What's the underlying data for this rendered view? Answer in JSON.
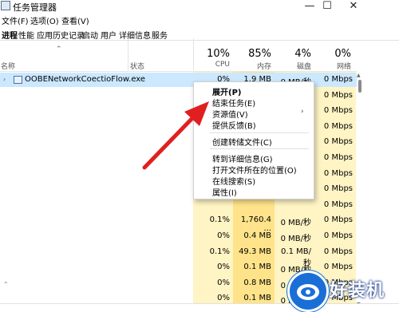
{
  "window": {
    "title": "任务管理器",
    "controls": {
      "minimize": "—",
      "maximize": "☐",
      "close": "✕"
    }
  },
  "menubar": {
    "items": [
      "文件(F)",
      "选项(O)",
      "查看(V)"
    ]
  },
  "tabs": [
    {
      "label": "进程",
      "active": true
    },
    {
      "label": "性能",
      "active": false
    },
    {
      "label": "应用历史记录",
      "active": false
    },
    {
      "label": "启动",
      "active": false
    },
    {
      "label": "用户",
      "active": false
    },
    {
      "label": "详细信息",
      "active": false
    },
    {
      "label": "服务",
      "active": false
    }
  ],
  "columns": {
    "name": "名称",
    "status": "状态",
    "cpu": {
      "pct": "10%",
      "label": "CPU"
    },
    "memory": {
      "pct": "85%",
      "label": "内存"
    },
    "disk": {
      "pct": "4%",
      "label": "磁盘"
    },
    "network": {
      "pct": "0%",
      "label": "网络"
    }
  },
  "selected_process": "OOBENetworkCoectioFlow.exe",
  "rows": [
    {
      "cpu": "0%",
      "mem": "1.9 MB",
      "disk": "0 MB/秒",
      "net": "0 Mbps"
    },
    {
      "cpu": "",
      "mem": "",
      "disk": "",
      "net": "0 Mbps"
    },
    {
      "cpu": "",
      "mem": "",
      "disk": "",
      "net": "0 Mbps"
    },
    {
      "cpu": "",
      "mem": "",
      "disk": "",
      "net": "0 Mbps"
    },
    {
      "cpu": "",
      "mem": "",
      "disk": "",
      "net": "0 Mbps"
    },
    {
      "cpu": "",
      "mem": "",
      "disk": "",
      "net": "0 Mbps"
    },
    {
      "cpu": "",
      "mem": "",
      "disk": "",
      "net": "0 Mbps"
    },
    {
      "cpu": "",
      "mem": "",
      "disk": "",
      "net": "0 Mbps"
    },
    {
      "cpu": "",
      "mem": "",
      "disk": "",
      "net": "0 Mbps"
    },
    {
      "cpu": "0.1%",
      "mem": "1,760.4 ...",
      "disk": "0 MB/秒",
      "net": "0 Mbps"
    },
    {
      "cpu": "0%",
      "mem": "0.4 MB",
      "disk": "0 MB/秒",
      "net": "0 Mbps"
    },
    {
      "cpu": "0.1%",
      "mem": "49.3 MB",
      "disk": "0.1 MB/秒",
      "net": "0 Mbps"
    },
    {
      "cpu": "0%",
      "mem": "0.1 MB",
      "disk": "0 MB/秒",
      "net": "0 Mbps"
    },
    {
      "cpu": "0%",
      "mem": "0.8 MB",
      "disk": "0 MB/秒",
      "net": "0 Mbps"
    },
    {
      "cpu": "0%",
      "mem": "0.1 MB",
      "disk": "0 MB/秒",
      "net": "0 Mbps"
    }
  ],
  "context_menu": {
    "items": [
      {
        "label": "展开(P)",
        "bold": true
      },
      {
        "label": "结束任务(E)"
      },
      {
        "label": "资源值(V)",
        "submenu": true
      },
      {
        "label": "提供反馈(B)"
      },
      {
        "label": "创建转储文件(C)"
      },
      {
        "label": "转到详细信息(G)"
      },
      {
        "label": "打开文件所在的位置(O)"
      },
      {
        "label": "在线搜索(S)"
      },
      {
        "label": "属性(I)"
      }
    ]
  },
  "watermark": {
    "text": "好装机"
  },
  "colors": {
    "selected_row": "#cce8ff",
    "cpu_col": "#fff4c4",
    "mem_col": "#ffe38a",
    "disk_col": "#fff4c4",
    "net_col": "#fff4c4",
    "arrow": "#e02020",
    "watermark_blue": "#1a6fd6"
  },
  "icons": {
    "app": "task-manager-icon",
    "process": "window-icon",
    "expander": "chevron-right-icon",
    "sort": "chevron-up-icon",
    "submenu": "chevron-right-icon"
  }
}
